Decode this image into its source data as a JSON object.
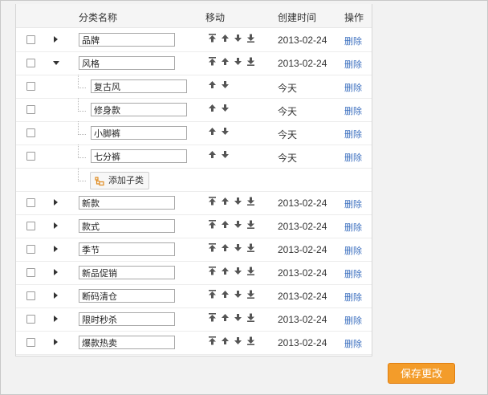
{
  "table": {
    "columns": {
      "name": "分类名称",
      "move": "移动",
      "created": "创建时间",
      "action": "操作"
    },
    "rows": [
      {
        "level": 1,
        "toggle": "collapsed",
        "name": "品牌",
        "arrows": 4,
        "date": "2013-02-24",
        "action": "删除"
      },
      {
        "level": 1,
        "toggle": "expanded",
        "name": "风格",
        "arrows": 4,
        "date": "2013-02-24",
        "action": "删除"
      },
      {
        "level": 2,
        "toggle": "none",
        "name": "复古风",
        "arrows": 2,
        "date": "今天",
        "action": "删除"
      },
      {
        "level": 2,
        "toggle": "none",
        "name": "修身款",
        "arrows": 2,
        "date": "今天",
        "action": "删除"
      },
      {
        "level": 2,
        "toggle": "none",
        "name": "小脚裤",
        "arrows": 2,
        "date": "今天",
        "action": "删除"
      },
      {
        "level": 2,
        "toggle": "none",
        "name": "七分裤",
        "arrows": 2,
        "date": "今天",
        "action": "删除"
      },
      {
        "level": 2,
        "type": "add",
        "label": "添加子类"
      },
      {
        "level": 1,
        "toggle": "collapsed",
        "name": "新款",
        "arrows": 4,
        "date": "2013-02-24",
        "action": "删除"
      },
      {
        "level": 1,
        "toggle": "collapsed",
        "name": "款式",
        "arrows": 4,
        "date": "2013-02-24",
        "action": "删除"
      },
      {
        "level": 1,
        "toggle": "collapsed",
        "name": "季节",
        "arrows": 4,
        "date": "2013-02-24",
        "action": "删除"
      },
      {
        "level": 1,
        "toggle": "collapsed",
        "name": "新品促销",
        "arrows": 4,
        "date": "2013-02-24",
        "action": "删除"
      },
      {
        "level": 1,
        "toggle": "collapsed",
        "name": "断码清仓",
        "arrows": 4,
        "date": "2013-02-24",
        "action": "删除"
      },
      {
        "level": 1,
        "toggle": "collapsed",
        "name": "限时秒杀",
        "arrows": 4,
        "date": "2013-02-24",
        "action": "删除"
      },
      {
        "level": 1,
        "toggle": "collapsed",
        "name": "爆款热卖",
        "arrows": 4,
        "date": "2013-02-24",
        "action": "删除"
      }
    ]
  },
  "footer": {
    "save_label": "保存更改"
  },
  "colors": {
    "save_button": "#f39c2a",
    "link": "#3b6fbf",
    "add_icon": "#e08a1e"
  },
  "icons": {
    "move_four": [
      "move-top-icon",
      "move-up-icon",
      "move-down-icon",
      "move-bottom-icon"
    ],
    "move_two": [
      "move-up-icon",
      "move-down-icon"
    ],
    "add": "add-category-icon"
  }
}
